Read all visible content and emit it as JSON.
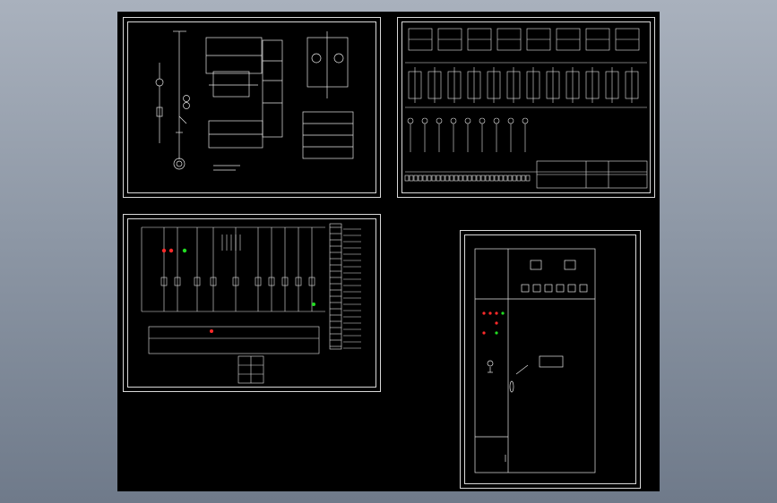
{
  "viewport": {
    "background_top": "#a9b1bd",
    "background_bottom": "#6f7a8a",
    "model_space": "#000000",
    "line_color": "#e6e6e6",
    "accent_red": "#ff2a2a",
    "accent_green": "#22dd22"
  },
  "sheets": {
    "primary": {
      "name": "primary-circuit-sheet"
    },
    "panel_wiring": {
      "name": "panel-wiring-sheet"
    },
    "control": {
      "name": "control-circuit-sheet"
    },
    "elevation": {
      "name": "cabinet-front-elevation-sheet"
    }
  },
  "icons": [
    "motor-symbol-icon",
    "indicator-lamp-icon",
    "meter-icon",
    "switch-handle-icon"
  ]
}
